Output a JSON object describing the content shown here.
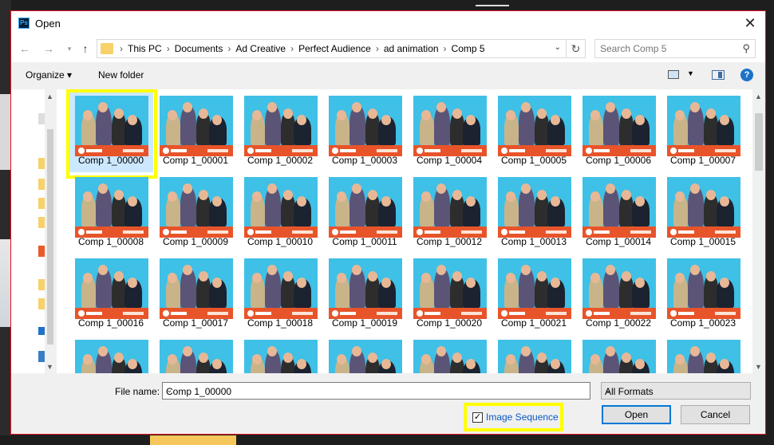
{
  "dialog": {
    "title": "Open",
    "app_icon": "Ps"
  },
  "address": {
    "crumbs": [
      "This PC",
      "Documents",
      "Ad Creative",
      "Perfect Audience",
      "ad animation",
      "Comp 5"
    ]
  },
  "search": {
    "placeholder": "Search Comp 5"
  },
  "toolbar": {
    "organize": "Organize ▾",
    "new_folder": "New folder"
  },
  "files": [
    "Comp 1_00000",
    "Comp 1_00001",
    "Comp 1_00002",
    "Comp 1_00003",
    "Comp 1_00004",
    "Comp 1_00005",
    "Comp 1_00006",
    "Comp 1_00007",
    "Comp 1_00008",
    "Comp 1_00009",
    "Comp 1_00010",
    "Comp 1_00011",
    "Comp 1_00012",
    "Comp 1_00013",
    "Comp 1_00014",
    "Comp 1_00015",
    "Comp 1_00016",
    "Comp 1_00017",
    "Comp 1_00018",
    "Comp 1_00019",
    "Comp 1_00020",
    "Comp 1_00021",
    "Comp 1_00022",
    "Comp 1_00023",
    "",
    "",
    "",
    "",
    "",
    "",
    "",
    ""
  ],
  "selected_index": 0,
  "bottom": {
    "file_name_label": "File name:",
    "file_name_value": "Comp 1_00000",
    "formats": "All Formats",
    "image_sequence_label": "Image Sequence",
    "image_sequence_checked": true,
    "open_label": "Open",
    "cancel_label": "Cancel"
  },
  "colors": {
    "highlight": "#ffff00",
    "selection": "#cce8ff",
    "thumb_bg": "#3fc0e6",
    "thumb_bar": "#e8542a"
  }
}
